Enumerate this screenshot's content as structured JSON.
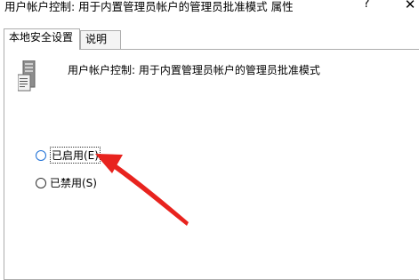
{
  "window": {
    "title": "用户帐户控制: 用于内置管理员帐户的管理员批准模式 属性",
    "help_label": "?",
    "close_label": "✕"
  },
  "tabs": [
    {
      "label": "本地安全设置",
      "active": true
    },
    {
      "label": "说明",
      "active": false
    }
  ],
  "policy": {
    "icon": "server-policy-icon",
    "description": "用户帐户控制: 用于内置管理员帐户的管理员批准模式"
  },
  "options": [
    {
      "label": "已启用(E)",
      "selected": false,
      "focused": true
    },
    {
      "label": "已禁用(S)",
      "selected": false,
      "focused": false
    }
  ],
  "annotation": {
    "color": "#e8231e"
  }
}
